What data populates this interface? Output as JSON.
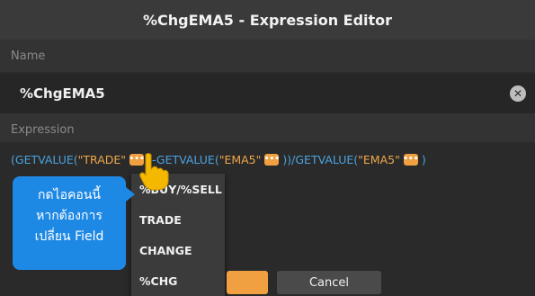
{
  "window": {
    "title": "%ChgEMA5 - Expression Editor"
  },
  "name_section": {
    "label": "Name",
    "value": "%ChgEMA5",
    "clear_icon": "close-circle-icon"
  },
  "expression_section": {
    "label": "Expression",
    "tokens": {
      "t1": "(GETVALUE(",
      "t2": "\"TRADE\"",
      "t3": ")-GETVALUE(",
      "t4": "\"EMA5\"",
      "t5": "))/GETVALUE(",
      "t6": "\"EMA5\"",
      "t7": ")"
    },
    "field_button_icon": "more-dots-icon"
  },
  "field_dropdown": {
    "items": [
      "%BUY/%SELL",
      "TRADE",
      "CHANGE",
      "%CHG"
    ]
  },
  "tooltip": {
    "lines": [
      "กดไอคอนนี้",
      "หากต้องการ",
      "เปลี่ยน Field"
    ]
  },
  "hand_icon": "pointing-hand-icon",
  "footer": {
    "ok_label": "OK",
    "cancel_label": "Cancel"
  },
  "colors": {
    "function": "#4aa3df",
    "string": "#f0a64b",
    "accent": "#f0a040",
    "tooltip": "#1e88e5"
  }
}
